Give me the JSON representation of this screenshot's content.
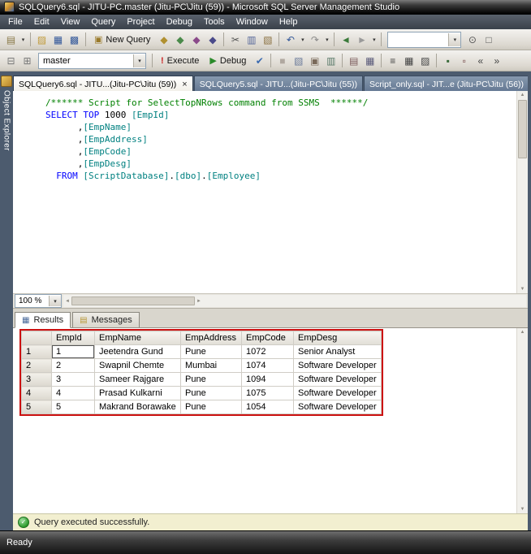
{
  "window": {
    "title": "SQLQuery6.sql - JITU-PC.master (Jitu-PC\\Jitu (59)) - Microsoft SQL Server Management Studio",
    "status_ready": "Ready"
  },
  "glyphs": {
    "caret": "▾",
    "close": "×",
    "check": "✓",
    "scroll_up": "▲",
    "scroll_down": "▼",
    "scroll_left": "◄",
    "scroll_right": "►"
  },
  "menu": {
    "items": [
      "File",
      "Edit",
      "View",
      "Query",
      "Project",
      "Debug",
      "Tools",
      "Window",
      "Help"
    ]
  },
  "toolbar_standard": {
    "items": [
      {
        "kind": "icon",
        "name": "new-item-icon",
        "glyph": "▤",
        "color": "#8a7a4a"
      },
      {
        "kind": "caret",
        "name": "new-item-dropdown-caret"
      },
      {
        "kind": "sep"
      },
      {
        "kind": "icon",
        "name": "open-file-icon",
        "glyph": "▨",
        "color": "#c09a3a"
      },
      {
        "kind": "icon",
        "name": "save-icon",
        "glyph": "▦",
        "color": "#33589a"
      },
      {
        "kind": "icon",
        "name": "save-all-icon",
        "glyph": "▩",
        "color": "#33589a"
      },
      {
        "kind": "sep"
      },
      {
        "kind": "button",
        "name": "new-query-button",
        "icon_glyph": "▣",
        "icon_color": "#9a7a2a",
        "label": "New Query"
      },
      {
        "kind": "icon",
        "name": "database-engine-query-icon",
        "glyph": "◆",
        "color": "#b09030"
      },
      {
        "kind": "icon",
        "name": "analysis-services-mdx-query-icon",
        "glyph": "◆",
        "color": "#4a8a4a"
      },
      {
        "kind": "icon",
        "name": "analysis-services-dmx-query-icon",
        "glyph": "◆",
        "color": "#8a4a8a"
      },
      {
        "kind": "icon",
        "name": "analysis-services-xmla-query-icon",
        "glyph": "◆",
        "color": "#4a4a8a"
      },
      {
        "kind": "sep"
      },
      {
        "kind": "icon",
        "name": "cut-icon",
        "glyph": "✂",
        "color": "#555555"
      },
      {
        "kind": "icon",
        "name": "copy-icon",
        "glyph": "▥",
        "color": "#556699"
      },
      {
        "kind": "icon",
        "name": "paste-icon",
        "glyph": "▧",
        "color": "#8a7040"
      },
      {
        "kind": "sep"
      },
      {
        "kind": "icon",
        "name": "undo-icon",
        "glyph": "↶",
        "color": "#33589a"
      },
      {
        "kind": "caret",
        "name": "undo-dropdown-caret"
      },
      {
        "kind": "icon",
        "name": "redo-icon",
        "glyph": "↷",
        "color": "#8a8a8a"
      },
      {
        "kind": "caret",
        "name": "redo-dropdown-caret"
      },
      {
        "kind": "sep"
      },
      {
        "kind": "icon",
        "name": "navigate-backward-icon",
        "glyph": "◄",
        "color": "#3a7a3a"
      },
      {
        "kind": "icon",
        "name": "navigate-forward-icon",
        "glyph": "►",
        "color": "#9a9a9a"
      },
      {
        "kind": "caret",
        "name": "navigate-dropdown-caret"
      },
      {
        "kind": "sep"
      },
      {
        "kind": "combo",
        "name": "quick-find-combo",
        "value": "",
        "width": 84
      },
      {
        "kind": "icon",
        "name": "find-icon",
        "glyph": "⊙",
        "color": "#555555"
      },
      {
        "kind": "icon",
        "name": "properties-window-icon",
        "glyph": "□",
        "color": "#555555"
      }
    ]
  },
  "toolbar_sql": {
    "items": [
      {
        "kind": "icon",
        "name": "connect-database-icon",
        "glyph": "⊟",
        "color": "#777777"
      },
      {
        "kind": "icon",
        "name": "change-connection-icon",
        "glyph": "⊞",
        "color": "#777777"
      },
      {
        "kind": "combo",
        "name": "available-databases-combo",
        "value": "master",
        "width": 126
      },
      {
        "kind": "sep"
      },
      {
        "kind": "button",
        "name": "execute-button",
        "icon_glyph": "!",
        "icon_color": "#cc2222",
        "label": "Execute"
      },
      {
        "kind": "button",
        "name": "debug-button",
        "icon_glyph": "▶",
        "icon_color": "#2a8a2a",
        "label": "Debug"
      },
      {
        "kind": "icon",
        "name": "parse-icon",
        "glyph": "✔",
        "color": "#3a6ab0"
      },
      {
        "kind": "sep"
      },
      {
        "kind": "icon",
        "name": "cancel-executing-query-icon",
        "glyph": "■",
        "color": "#b0a8a0"
      },
      {
        "kind": "icon",
        "name": "display-estimated-plan-icon",
        "glyph": "▧",
        "color": "#6a7a9a"
      },
      {
        "kind": "icon",
        "name": "query-options-icon",
        "glyph": "▣",
        "color": "#7a6a5a"
      },
      {
        "kind": "icon",
        "name": "intellisense-enabled-icon",
        "glyph": "▥",
        "color": "#5a7a6a"
      },
      {
        "kind": "sep"
      },
      {
        "kind": "icon",
        "name": "include-actual-plan-icon",
        "glyph": "▤",
        "color": "#7a5a5a"
      },
      {
        "kind": "icon",
        "name": "include-client-statistics-icon",
        "glyph": "▦",
        "color": "#5a5a7a"
      },
      {
        "kind": "sep"
      },
      {
        "kind": "icon",
        "name": "results-to-text-icon",
        "glyph": "≡",
        "color": "#444444"
      },
      {
        "kind": "icon",
        "name": "results-to-grid-icon",
        "glyph": "▦",
        "color": "#444444"
      },
      {
        "kind": "icon",
        "name": "results-to-file-icon",
        "glyph": "▨",
        "color": "#444444"
      },
      {
        "kind": "sep"
      },
      {
        "kind": "icon",
        "name": "comment-out-lines-icon",
        "glyph": "▪",
        "color": "#3a6a3a"
      },
      {
        "kind": "icon",
        "name": "uncomment-lines-icon",
        "glyph": "▫",
        "color": "#6a3a3a"
      },
      {
        "kind": "icon",
        "name": "decrease-indent-icon",
        "glyph": "«",
        "color": "#444444"
      },
      {
        "kind": "icon",
        "name": "increase-indent-icon",
        "glyph": "»",
        "color": "#444444"
      }
    ]
  },
  "object_explorer": {
    "label": "Object Explorer"
  },
  "tabs": [
    {
      "label": "SQLQuery6.sql - JITU...(Jitu-PC\\Jitu (59))",
      "active": true,
      "has_close": true
    },
    {
      "label": "SQLQuery5.sql - JITU...(Jitu-PC\\Jitu (55))",
      "active": false,
      "has_close": false
    },
    {
      "label": "Script_only.sql - JIT...e (Jitu-PC\\Jitu (56))",
      "active": false,
      "has_close": false
    }
  ],
  "editor": {
    "zoom_value": "100 %",
    "lines": [
      [
        {
          "t": "/****** Script for SelectTopNRows command from SSMS  ******/",
          "c": "comment"
        }
      ],
      [
        {
          "t": "SELECT",
          "c": "keyword"
        },
        {
          "t": " ",
          "c": "plain"
        },
        {
          "t": "TOP",
          "c": "keyword"
        },
        {
          "t": " 1000 ",
          "c": "plain"
        },
        {
          "t": "[EmpId]",
          "c": "ident"
        }
      ],
      [
        {
          "t": "      ,",
          "c": "plain"
        },
        {
          "t": "[EmpName]",
          "c": "ident"
        }
      ],
      [
        {
          "t": "      ,",
          "c": "plain"
        },
        {
          "t": "[EmpAddress]",
          "c": "ident"
        }
      ],
      [
        {
          "t": "      ,",
          "c": "plain"
        },
        {
          "t": "[EmpCode]",
          "c": "ident"
        }
      ],
      [
        {
          "t": "      ,",
          "c": "plain"
        },
        {
          "t": "[EmpDesg]",
          "c": "ident"
        }
      ],
      [
        {
          "t": "  ",
          "c": "plain"
        },
        {
          "t": "FROM",
          "c": "keyword"
        },
        {
          "t": " ",
          "c": "plain"
        },
        {
          "t": "[ScriptDatabase]",
          "c": "ident"
        },
        {
          "t": ".",
          "c": "plain"
        },
        {
          "t": "[dbo]",
          "c": "ident"
        },
        {
          "t": ".",
          "c": "plain"
        },
        {
          "t": "[Employee]",
          "c": "ident"
        }
      ]
    ]
  },
  "results_pane": {
    "tabs": [
      {
        "label": "Results",
        "icon_name": "results-grid-icon",
        "icon_glyph": "▦",
        "icon_color": "#4a6a9a",
        "active": true
      },
      {
        "label": "Messages",
        "icon_name": "messages-icon",
        "icon_glyph": "▤",
        "icon_color": "#b8983a",
        "active": false
      }
    ],
    "grid": {
      "columns": [
        "EmpId",
        "EmpName",
        "EmpAddress",
        "EmpCode",
        "EmpDesg"
      ],
      "rows": [
        [
          "1",
          "Jeetendra Gund",
          "Pune",
          "1072",
          "Senior Analyst"
        ],
        [
          "2",
          "Swapnil Chemte",
          "Mumbai",
          "1074",
          "Software Developer"
        ],
        [
          "3",
          "Sameer Rajgare",
          "Pune",
          "1094",
          "Software Developer"
        ],
        [
          "4",
          "Prasad Kulkarni",
          "Pune",
          "1075",
          "Software Developer"
        ],
        [
          "5",
          "Makrand Borawake",
          "Pune",
          "1054",
          "Software Developer"
        ]
      ],
      "selected_cell": {
        "row": 0,
        "col": 0
      }
    },
    "status_text": "Query executed successfully."
  },
  "annotation": {
    "color": "#cc1111"
  }
}
